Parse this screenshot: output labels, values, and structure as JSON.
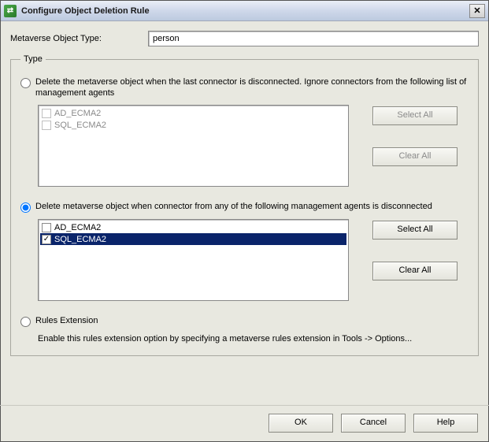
{
  "window": {
    "title": "Configure Object Deletion Rule"
  },
  "objectType": {
    "label": "Metaverse Object Type:",
    "value": "person"
  },
  "group": {
    "legend": "Type"
  },
  "option1": {
    "label": "Delete the metaverse object when the last connector is disconnected. Ignore connectors from the following list of management agents",
    "items": [
      {
        "name": "AD_ECMA2",
        "checked": false
      },
      {
        "name": "SQL_ECMA2",
        "checked": false
      }
    ],
    "selectAll": "Select All",
    "clearAll": "Clear All"
  },
  "option2": {
    "label": "Delete metaverse object when connector from any of the following management agents is disconnected",
    "items": [
      {
        "name": "AD_ECMA2",
        "checked": false,
        "selected": false
      },
      {
        "name": "SQL_ECMA2",
        "checked": true,
        "selected": true
      }
    ],
    "selectAll": "Select All",
    "clearAll": "Clear All"
  },
  "option3": {
    "label": "Rules Extension",
    "desc": "Enable this rules extension option by specifying a metaverse rules extension in Tools -> Options..."
  },
  "buttons": {
    "ok": "OK",
    "cancel": "Cancel",
    "help": "Help"
  }
}
